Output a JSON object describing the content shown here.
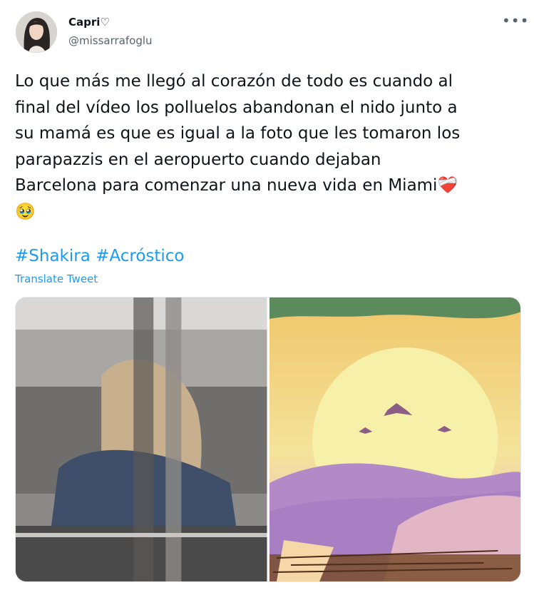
{
  "author": {
    "display_name": "Capri♡",
    "handle": "@missarrafoglu",
    "avatar_icon": "profile-photo"
  },
  "more_icon": "more-horizontal-icon",
  "tweet": {
    "text": "Lo que más me llegó al corazón de todo es cuando al\nfinal del vídeo los polluelos abandonan el nido junto a\nsu mamá es que es igual a la foto que les tomaron los\nparapazzis en el aeropuerto cuando dejaban\nBarcelona para comenzar una nueva vida en Miami❤️‍🩹\n🥹",
    "hashtags": [
      "#Shakira",
      "#Acróstico"
    ],
    "translate_label": "Translate Tweet"
  },
  "media": {
    "photos": [
      {
        "description_icon": "airport-photo"
      },
      {
        "description_icon": "illustration-birds-nest"
      }
    ]
  },
  "colors": {
    "link": "#1d9bf0",
    "text": "#0f1419",
    "secondary": "#536471"
  }
}
